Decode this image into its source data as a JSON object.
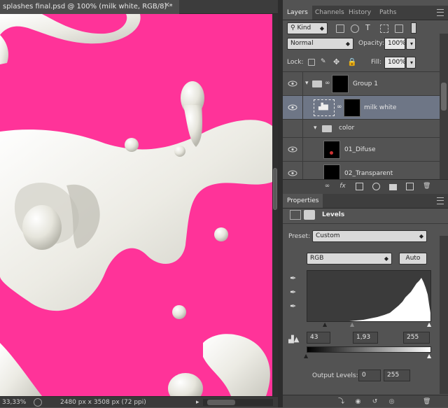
{
  "document": {
    "tab_title": "splashes final.psd @ 100% (milk white, RGB/8) *",
    "close": "×",
    "canvas_color": "#ff3399"
  },
  "status": {
    "zoom": "33,33%",
    "doc_info": "2480 px x 3508 px (72 ppi)",
    "arrow": "▸"
  },
  "layers_panel": {
    "tabs": [
      "Layers",
      "Channels",
      "History",
      "Paths"
    ],
    "filter": "Kind",
    "blend_mode": "Normal",
    "opacity_label": "Opacity:",
    "opacity_value": "100%",
    "lock_label": "Lock:",
    "fill_label": "Fill:",
    "fill_value": "100%",
    "layers": [
      {
        "name": "Group 1"
      },
      {
        "name": "milk white"
      },
      {
        "name": "color"
      },
      {
        "name": "01_Difuse"
      },
      {
        "name": "02_Transparent"
      }
    ]
  },
  "properties_panel": {
    "tab": "Properties",
    "adjustment": "Levels",
    "preset_label": "Preset:",
    "preset_value": "Custom",
    "channel": "RGB",
    "auto_label": "Auto",
    "input_black": "43",
    "input_gamma": "1,93",
    "input_white": "255",
    "output_label": "Output Levels:",
    "output_black": "0",
    "output_white": "255"
  }
}
